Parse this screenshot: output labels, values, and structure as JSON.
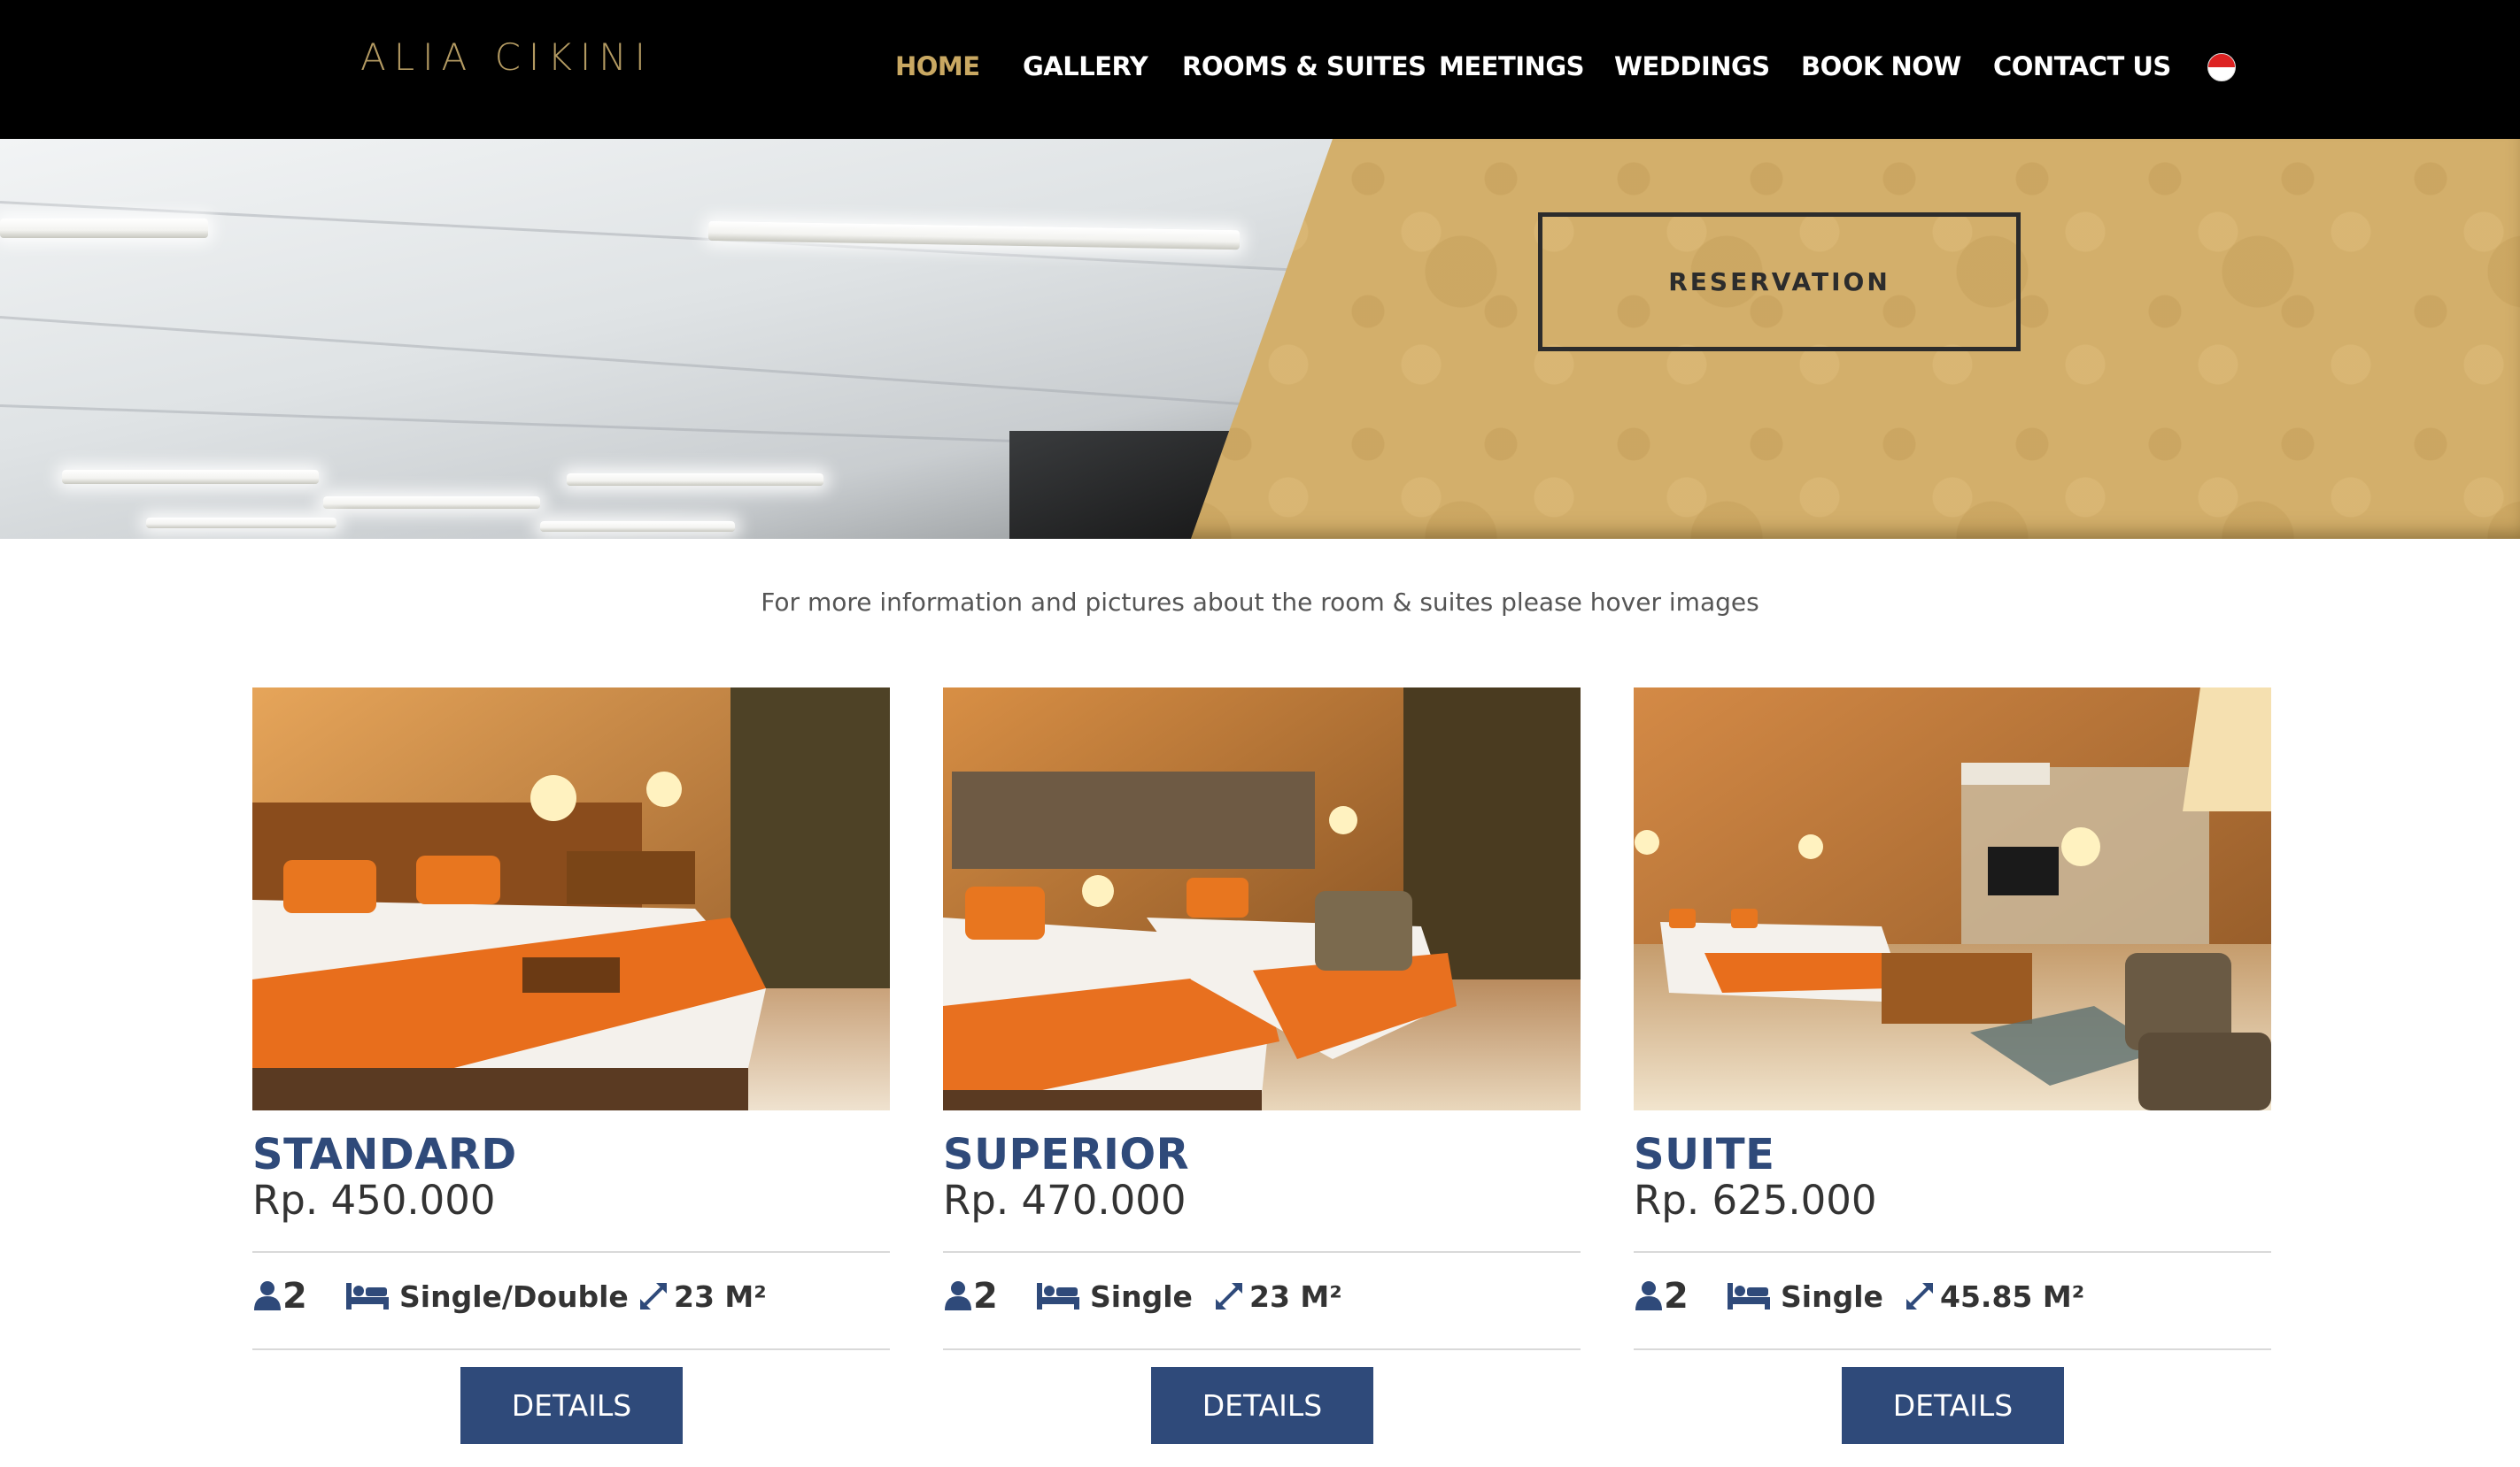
{
  "brand": {
    "logo_text": "ALIA CIKINI"
  },
  "nav": {
    "items": [
      {
        "label": "HOME",
        "active": true
      },
      {
        "label": "GALLERY",
        "active": false
      },
      {
        "label": "ROOMS & SUITES",
        "active": false
      },
      {
        "label": "MEETINGS",
        "active": false
      },
      {
        "label": "WEDDINGS",
        "active": false
      },
      {
        "label": "BOOK NOW",
        "active": false
      },
      {
        "label": "CONTACT US",
        "active": false
      }
    ],
    "language_flag": "indonesia-flag-icon"
  },
  "hero": {
    "reservation_label": "RESERVATION"
  },
  "intro": {
    "text": "For more information and pictures about the room & suites please hover images"
  },
  "rooms": [
    {
      "name": "STANDARD",
      "price": "Rp. 450.000",
      "guests": "2",
      "bed": "Single/Double",
      "size": "23 M²",
      "details_label": "DETAILS"
    },
    {
      "name": "SUPERIOR",
      "price": "Rp. 470.000",
      "guests": "2",
      "bed": "Single",
      "size": "23 M²",
      "details_label": "DETAILS"
    },
    {
      "name": "SUITE",
      "price": "Rp. 625.000",
      "guests": "2",
      "bed": "Single",
      "size": "45.85 M²",
      "details_label": "DETAILS"
    }
  ],
  "icons": {
    "guests": "user-icon",
    "bed": "bed-icon",
    "size": "expand-icon"
  },
  "colors": {
    "header_bg": "#000000",
    "nav_active": "#c9a862",
    "logo": "#b39a62",
    "accent_blue": "#2f4a7a",
    "hero_gold": "#d3af6b"
  }
}
